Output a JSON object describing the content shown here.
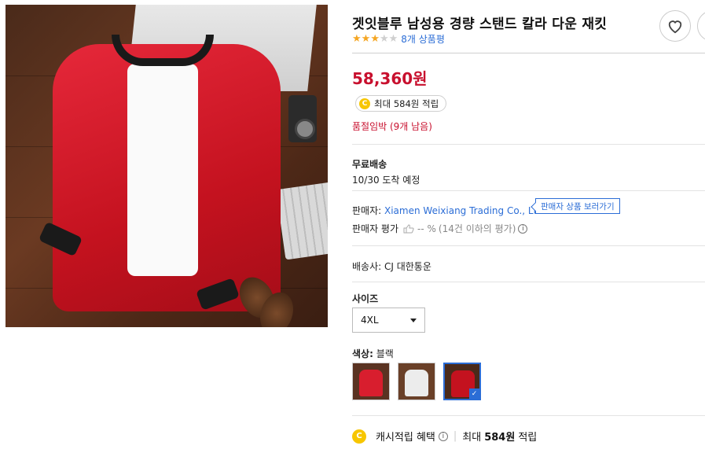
{
  "product": {
    "title": "겟잇블루 남성용 경량 스탠드 칼라 다운 재킷",
    "rating_stars": 3,
    "rating_max": 5,
    "review_count_label": "8개 상품평",
    "price": "58,360원",
    "reward_coin": "C",
    "reward_label": "최대 584원 적립",
    "stock_label": "품절임박 (9개 남음)"
  },
  "shipping": {
    "title": "무료배송",
    "eta": "10/30 도착 예정"
  },
  "seller": {
    "label": "판매자:",
    "name": "Xiamen Weixiang Trading Co., Ltd.",
    "view_products_button": "판매자 상품 보러가기",
    "rating_label": "판매자 평가",
    "rating_value": "-- %",
    "rating_note": "(14건 이하의 평가)"
  },
  "carrier": {
    "label": "배송사: CJ 대한통운"
  },
  "options": {
    "size_label": "사이즈",
    "size_selected": "4XL",
    "color_label": "색상:",
    "color_selected": "블랙",
    "swatches": [
      {
        "name": "red",
        "selected": false
      },
      {
        "name": "white",
        "selected": false
      },
      {
        "name": "red-alt",
        "selected": true
      }
    ]
  },
  "cash_benefit": {
    "coin": "C",
    "label": "캐시적립 혜택",
    "info_icon": "i",
    "max_prefix": "최대",
    "max_amount": "584원",
    "max_suffix": "적립"
  },
  "icons": {
    "wishlist": "heart-icon",
    "share": "share-icon",
    "thumbs": "thumbs-up-icon",
    "info": "info-icon",
    "check": "check-icon"
  },
  "colors": {
    "price": "#c8102e",
    "link": "#2b6dd6",
    "star": "#f5a623",
    "coin": "#f7c600"
  }
}
